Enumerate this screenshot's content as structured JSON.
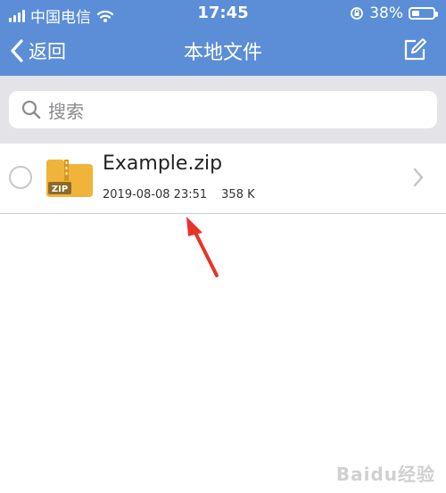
{
  "status_bar": {
    "carrier": "中国电信",
    "time": "17:45",
    "battery_percent": "38%",
    "battery_level": 0.38
  },
  "nav": {
    "back_label": "返回",
    "title": "本地文件",
    "edit_icon": "edit-icon"
  },
  "search": {
    "placeholder": "搜索"
  },
  "files": [
    {
      "name": "Example.zip",
      "date": "2019-08-08 23:51",
      "size": "358 K",
      "icon_badge": "ZIP",
      "selected": false
    }
  ],
  "watermark": "Baidu经验",
  "colors": {
    "header": "#5b8ed6",
    "search_bg": "#e4e4e8",
    "folder": "#f0b43a",
    "badge": "#8c6a2a",
    "annotation_arrow": "#e8332a"
  }
}
